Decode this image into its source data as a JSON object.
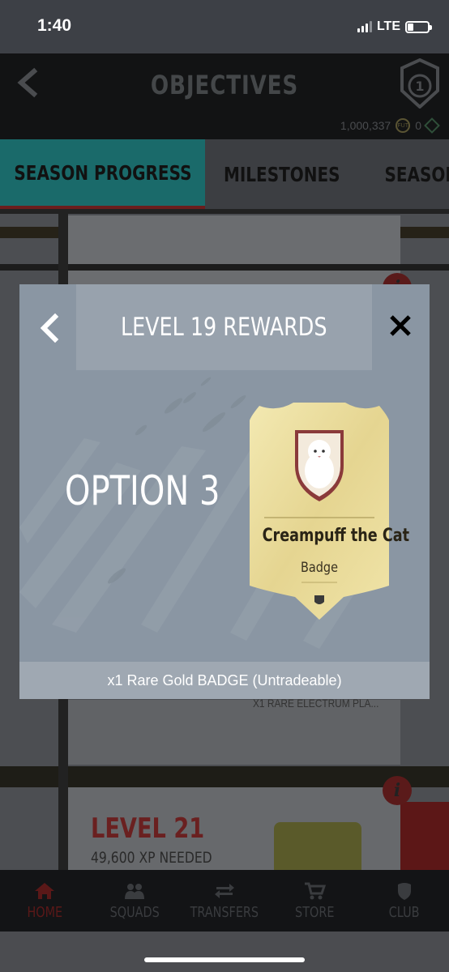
{
  "status_bar": {
    "time": "1:40",
    "network": "LTE"
  },
  "header": {
    "title": "OBJECTIVES",
    "coins": "1,000,337",
    "coin_label": "FUT",
    "points": "0"
  },
  "tabs": [
    {
      "label": "SEASON PROGRESS",
      "active": true
    },
    {
      "label": "MILESTONES",
      "active": false
    },
    {
      "label": "SEASON",
      "active": false
    }
  ],
  "background": {
    "behind_reward_text": "X1 RARE ELECTRUM PLA...",
    "level_label": "LEVEL 21",
    "xp_needed": "49,600 XP NEEDED"
  },
  "modal": {
    "title": "LEVEL 19 REWARDS",
    "option_label": "OPTION 3",
    "card": {
      "name": "Creampuff the Cat",
      "type": "Badge"
    },
    "reward_description": "x1 Rare Gold BADGE (Untradeable)"
  },
  "bottom_nav": [
    {
      "label": "HOME",
      "icon": "home-icon",
      "active": true
    },
    {
      "label": "SQUADS",
      "icon": "squads-icon",
      "active": false
    },
    {
      "label": "TRANSFERS",
      "icon": "transfers-icon",
      "active": false
    },
    {
      "label": "STORE",
      "icon": "cart-icon",
      "active": false
    },
    {
      "label": "CLUB",
      "icon": "club-icon",
      "active": false
    }
  ],
  "colors": {
    "accent_teal": "#1a6a6a",
    "accent_red": "#6b1d1d",
    "modal_bg": "#8a96a3",
    "card_gold": "#e8dc9c"
  }
}
